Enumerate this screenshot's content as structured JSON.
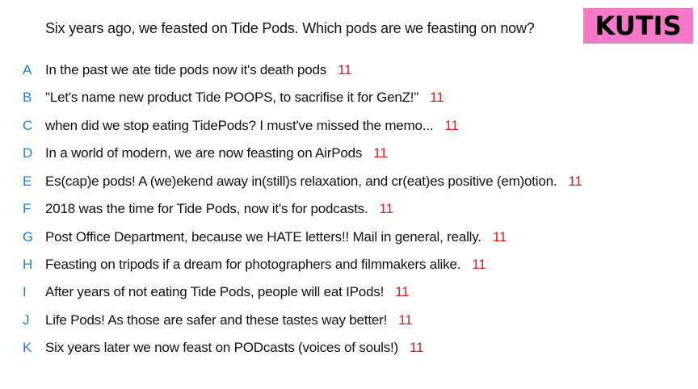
{
  "question": "Six years ago, we feasted on Tide Pods. Which pods are we feasting on now?",
  "logo": "KUTIS",
  "colors": {
    "letter": "#1e7fd8",
    "votes": "#e01a1a",
    "logo_bg": "#f47ac8"
  },
  "options": [
    {
      "letter": "A",
      "text": "In the past we ate tide pods now it's death pods",
      "votes": "11"
    },
    {
      "letter": "B",
      "text": "\"Let's name new product Tide POOPS, to sacrifise it for GenZ!\"",
      "votes": "11"
    },
    {
      "letter": "C",
      "text": "when did we stop eating TidePods? I must've missed the memo...",
      "votes": "11"
    },
    {
      "letter": "D",
      "text": "In a world of modern, we are now feasting on AirPods",
      "votes": "11"
    },
    {
      "letter": "E",
      "text": "Es(cap)e pods! A (we)ekend away in(still)s relaxation, and cr(eat)es positive (em)otion.",
      "votes": "11"
    },
    {
      "letter": "F",
      "text": "2018 was the time for Tide Pods, now it's for podcasts.",
      "votes": "11"
    },
    {
      "letter": "G",
      "text": "Post Office Department, because we HATE letters!! Mail in general, really.",
      "votes": "11"
    },
    {
      "letter": "H",
      "text": "Feasting on tripods if a dream for photographers and filmmakers alike.",
      "votes": "11"
    },
    {
      "letter": "I",
      "text": "After years of not eating Tide Pods, people will eat IPods!",
      "votes": "11"
    },
    {
      "letter": "J",
      "text": "Life Pods! As those are safer and these tastes way better!",
      "votes": "11"
    },
    {
      "letter": "K",
      "text": "Six years later we now feast on PODcasts (voices of souls!)",
      "votes": "11"
    }
  ]
}
